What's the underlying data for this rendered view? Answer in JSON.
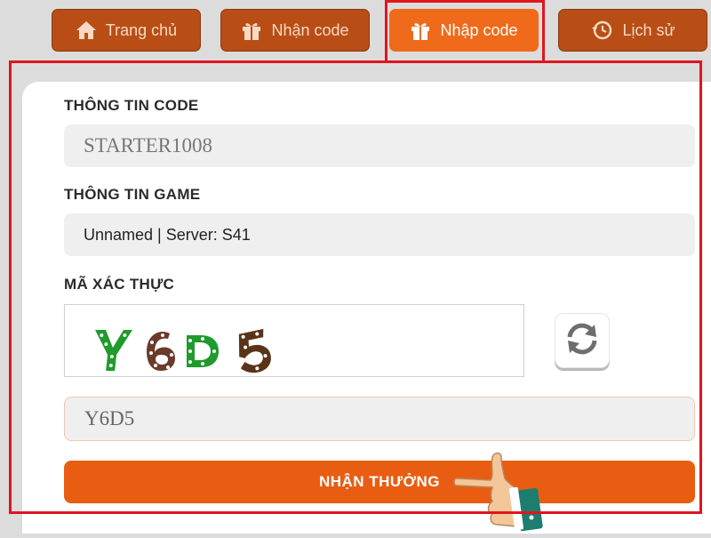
{
  "tabs": [
    {
      "label": "Trang chủ",
      "icon": "home-icon"
    },
    {
      "label": "Nhận code",
      "icon": "gift-icon"
    },
    {
      "label": "Nhập code",
      "icon": "gift-icon",
      "active": true
    },
    {
      "label": "Lịch sử",
      "icon": "history-icon"
    }
  ],
  "form": {
    "code_label": "THÔNG TIN CODE",
    "code_value": "STARTER1008",
    "game_label": "THÔNG TIN GAME",
    "game_value": "Unnamed | Server: S41",
    "captcha_label": "MÃ XÁC THỰC",
    "captcha_image_text": "Y6D5",
    "captcha_input_value": "Y6D5",
    "submit_label": "NHẬN THƯỞNG"
  },
  "colors": {
    "active_tab": "#ef6a1a",
    "inactive_tab": "#b84e16",
    "submit_button": "#e85d12",
    "highlight_frame": "#e0151f"
  }
}
